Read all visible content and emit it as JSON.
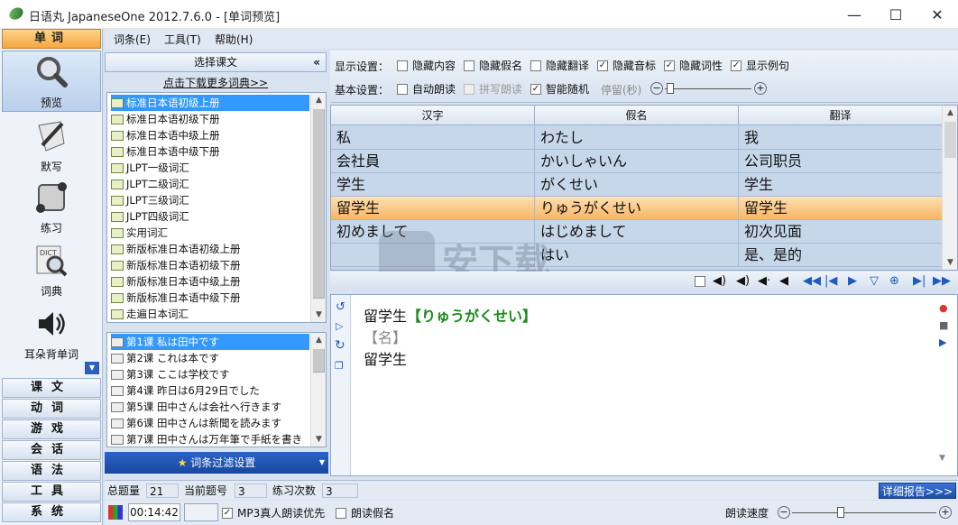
{
  "window": {
    "title": "日语丸 JapaneseOne 2012.7.6.0 - [单词预览]",
    "controls": {
      "minimize": "—",
      "maximize": "☐",
      "close": "✕"
    }
  },
  "menu": [
    "词条(E)",
    "工具(T)",
    "帮助(H)"
  ],
  "nav": {
    "header": "单词",
    "items": [
      {
        "label": "预览",
        "icon": "magnifier-icon"
      },
      {
        "label": "默写",
        "icon": "pen-icon"
      },
      {
        "label": "练习",
        "icon": "puzzle-icon"
      },
      {
        "label": "词典",
        "icon": "dictionary-icon"
      },
      {
        "label": "耳朵背单词",
        "icon": "speaker-icon"
      }
    ],
    "buttons": [
      "课文",
      "动词",
      "游戏",
      "会话",
      "语法",
      "工具",
      "系统"
    ]
  },
  "lesson_panel": {
    "header": "选择课文",
    "collapse": "«",
    "download_link": "点击下载更多词典>>",
    "books": [
      "标准日本语初级上册",
      "标准日本语初级下册",
      "标准日本语中级上册",
      "标准日本语中级下册",
      "JLPT一级词汇",
      "JLPT二级词汇",
      "JLPT三级词汇",
      "JLPT四级词汇",
      "实用词汇",
      "新版标准日本语初级上册",
      "新版标准日本语初级下册",
      "新版标准日本语中级上册",
      "新版标准日本语中级下册",
      "走遍日本词汇"
    ],
    "selected_book": 0,
    "lessons": [
      "第1课 私は田中です",
      "第2课 これは本です",
      "第3课 ここは学校です",
      "第4课 昨日は6月29日でした",
      "第5课 田中さんは会社へ行きます",
      "第6课 田中さんは新聞を読みます",
      "第7课 田中さんは万年筆で手紙を書き"
    ],
    "selected_lesson": 0,
    "filter_button": "词条过滤设置"
  },
  "settings": {
    "display_label": "显示设置：",
    "display": [
      {
        "label": "隐藏内容",
        "checked": false
      },
      {
        "label": "隐藏假名",
        "checked": false
      },
      {
        "label": "隐藏翻译",
        "checked": false
      },
      {
        "label": "隐藏音标",
        "checked": true
      },
      {
        "label": "隐藏词性",
        "checked": true
      },
      {
        "label": "显示例句",
        "checked": true
      }
    ],
    "basic_label": "基本设置：",
    "basic": [
      {
        "label": "自动朗读",
        "checked": false,
        "disabled": false
      },
      {
        "label": "拼写朗读",
        "checked": false,
        "disabled": true
      },
      {
        "label": "智能随机",
        "checked": true,
        "disabled": false
      }
    ],
    "pause_label": "停留(秒)"
  },
  "table": {
    "headers": [
      "汉字",
      "假名",
      "翻译"
    ],
    "rows": [
      [
        "私",
        "わたし",
        "我"
      ],
      [
        "会社員",
        "かいしゃいん",
        "公司职员"
      ],
      [
        "学生",
        "がくせい",
        "学生"
      ],
      [
        "留学生",
        "りゅうがくせい",
        "留学生"
      ],
      [
        "初めまして",
        "はじめまして",
        "初次见面"
      ],
      [
        "",
        "はい",
        "是、是的"
      ]
    ],
    "selected_row": 3
  },
  "detail": {
    "word": "留学生",
    "reading": "【りゅうがくせい】",
    "pos": "【名】",
    "meaning": "留学生"
  },
  "status": {
    "total_label": "总题量",
    "total": "21",
    "current_label": "当前题号",
    "current": "3",
    "practice_label": "练习次数",
    "practice": "3",
    "report_button": "详细报告>>>"
  },
  "bottom": {
    "time": "00:14:42",
    "mp3_label": "MP3真人朗读优先",
    "mp3_checked": true,
    "kana_label": "朗读假名",
    "kana_checked": false,
    "speed_label": "朗读速度"
  },
  "watermark": {
    "text": "安下载",
    "sub": "anxz.com"
  }
}
